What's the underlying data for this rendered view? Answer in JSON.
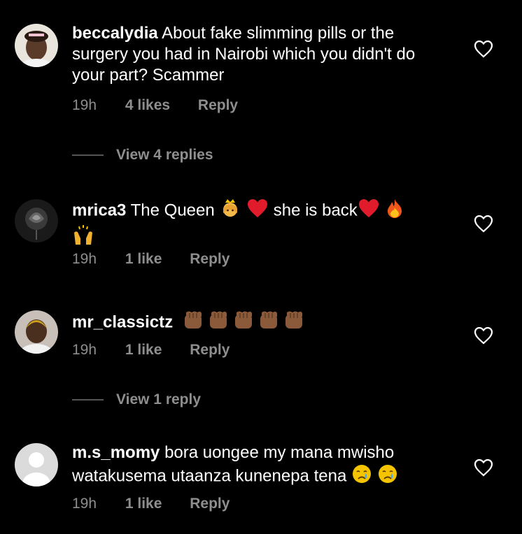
{
  "comments": [
    {
      "username": "beccalydia",
      "text": "About fake slimming pills or the surgery you had in Nairobi which you didn't do your part? Scammer",
      "time": "19h",
      "likes": "4 likes",
      "reply": "Reply",
      "view_replies": "View 4 replies"
    },
    {
      "username": "mrica3",
      "text_1": "The Queen",
      "text_2": "she is back",
      "time": "19h",
      "likes": "1 like",
      "reply": "Reply"
    },
    {
      "username": "mr_classictz",
      "time": "19h",
      "likes": "1 like",
      "reply": "Reply",
      "view_replies": "View 1 reply"
    },
    {
      "username": "m.s_momy",
      "text": "bora uongee my mana mwisho watakusema utaanza kunenepa tena",
      "time": "19h",
      "likes": "1 like",
      "reply": "Reply"
    }
  ],
  "icons": {
    "heart": "heart-outline-icon",
    "emoji_crown_woman": "princess-emoji",
    "emoji_heart": "red-heart-emoji",
    "emoji_fire": "fire-emoji",
    "emoji_raised_hands": "raised-hands-emoji",
    "emoji_fist": "raised-fist-dark-emoji",
    "emoji_crying": "crying-face-emoji"
  },
  "colors": {
    "background": "#000000",
    "secondary_text": "#8e8e8e"
  }
}
